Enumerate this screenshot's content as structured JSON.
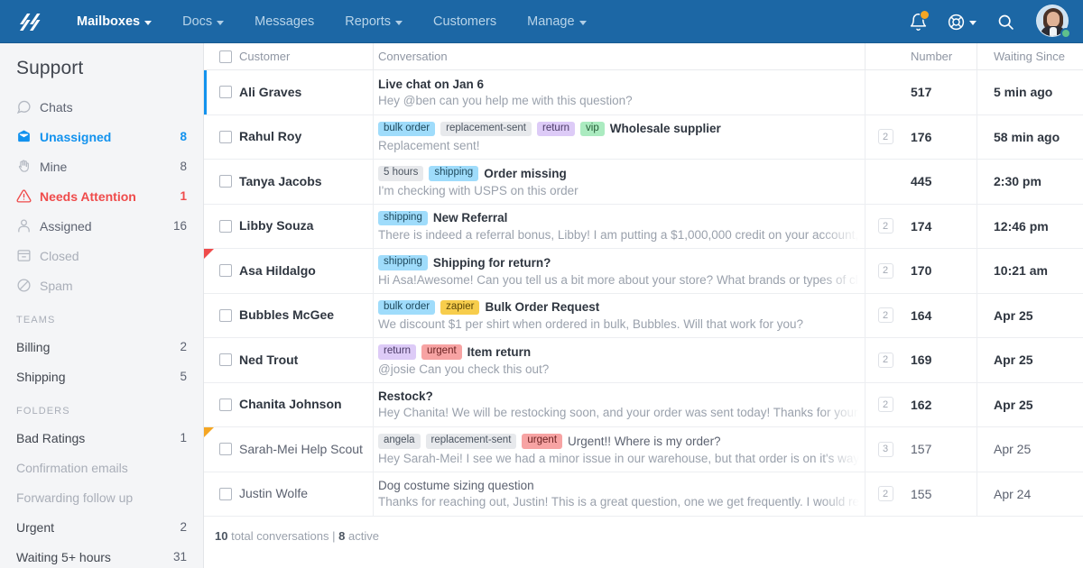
{
  "topnav": {
    "logo_name": "helpscout-logo",
    "items": [
      {
        "label": "Mailboxes",
        "caret": true,
        "active": true
      },
      {
        "label": "Docs",
        "caret": true,
        "active": false
      },
      {
        "label": "Messages",
        "caret": false,
        "active": false
      },
      {
        "label": "Reports",
        "caret": true,
        "active": false
      },
      {
        "label": "Customers",
        "caret": false,
        "active": false
      },
      {
        "label": "Manage",
        "caret": true,
        "active": false
      }
    ],
    "icons": [
      "bell-icon",
      "lifebuoy-help-icon",
      "search-icon",
      "avatar"
    ],
    "notification_badge": true,
    "status": "online",
    "bg_color": "#1c67a5"
  },
  "sidebar": {
    "title": "Support",
    "items": [
      {
        "label": "Chats",
        "count": "",
        "icon": "chat-bubble-icon",
        "state": "normal"
      },
      {
        "label": "Unassigned",
        "count": "8",
        "icon": "envelope-icon",
        "state": "selected"
      },
      {
        "label": "Mine",
        "count": "8",
        "icon": "hand-icon",
        "state": "normal"
      },
      {
        "label": "Needs Attention",
        "count": "1",
        "icon": "warning-icon",
        "state": "alert"
      },
      {
        "label": "Assigned",
        "count": "16",
        "icon": "person-icon",
        "state": "normal"
      },
      {
        "label": "Closed",
        "count": "",
        "icon": "archive-icon",
        "state": "muted"
      },
      {
        "label": "Spam",
        "count": "",
        "icon": "ban-icon",
        "state": "muted"
      }
    ],
    "teams_header": "TEAMS",
    "teams": [
      {
        "label": "Billing",
        "count": "2",
        "state": "normal"
      },
      {
        "label": "Shipping",
        "count": "5",
        "state": "normal"
      }
    ],
    "folders_header": "FOLDERS",
    "folders": [
      {
        "label": "Bad Ratings",
        "count": "1",
        "state": "normal"
      },
      {
        "label": "Confirmation emails",
        "count": "",
        "state": "muted"
      },
      {
        "label": "Forwarding follow up",
        "count": "",
        "state": "muted"
      },
      {
        "label": "Urgent",
        "count": "2",
        "state": "normal"
      },
      {
        "label": "Waiting 5+ hours",
        "count": "31",
        "state": "normal"
      }
    ],
    "accent_selected": "#1292ee",
    "accent_alert": "#ef4b4b"
  },
  "table": {
    "headers": {
      "customer": "Customer",
      "conversation": "Conversation",
      "number": "Number",
      "waiting_since": "Waiting Since"
    },
    "rows": [
      {
        "customer": "Ali Graves",
        "tags": [],
        "subject": "Live chat on Jan 6",
        "preview": "Hey @ben can you help me with this question?",
        "count": "",
        "number": "517",
        "waiting": "5 min ago",
        "unread": true,
        "marker": "selected"
      },
      {
        "customer": "Rahul Roy",
        "tags": [
          {
            "label": "bulk order",
            "color": "blue"
          },
          {
            "label": "replacement-sent",
            "color": "grey"
          },
          {
            "label": "return",
            "color": "purple"
          },
          {
            "label": "vip",
            "color": "green"
          }
        ],
        "subject": "Wholesale supplier",
        "preview": "Replacement sent!",
        "count": "2",
        "number": "176",
        "waiting": "58 min ago",
        "unread": true,
        "marker": "none"
      },
      {
        "customer": "Tanya Jacobs",
        "tags": [
          {
            "label": "5 hours",
            "color": "grey"
          },
          {
            "label": "shipping",
            "color": "blue"
          }
        ],
        "subject": "Order missing",
        "preview": "I'm checking with USPS on this order",
        "count": "",
        "number": "445",
        "waiting": "2:30 pm",
        "unread": true,
        "marker": "none"
      },
      {
        "customer": "Libby Souza",
        "tags": [
          {
            "label": "shipping",
            "color": "blue"
          }
        ],
        "subject": "New Referral",
        "preview": "There is indeed a referral bonus, Libby! I am putting a $1,000,000 credit on your account, so you shou",
        "count": "2",
        "number": "174",
        "waiting": "12:46 pm",
        "unread": true,
        "marker": "none"
      },
      {
        "customer": "Asa Hildalgo",
        "tags": [
          {
            "label": "shipping",
            "color": "blue"
          }
        ],
        "subject": "Shipping for return?",
        "preview": "Hi Asa!Awesome! Can you tell us a bit more about your store? What brands or types of clothing do yo",
        "count": "2",
        "number": "170",
        "waiting": "10:21 am",
        "unread": true,
        "marker": "red"
      },
      {
        "customer": "Bubbles McGee",
        "tags": [
          {
            "label": "bulk order",
            "color": "blue"
          },
          {
            "label": "zapier",
            "color": "yellow"
          }
        ],
        "subject": "Bulk Order Request",
        "preview": "We discount $1 per shirt when ordered in bulk, Bubbles. Will that work for you?",
        "count": "2",
        "number": "164",
        "waiting": "Apr 25",
        "unread": true,
        "marker": "none"
      },
      {
        "customer": "Ned Trout",
        "tags": [
          {
            "label": "return",
            "color": "purple"
          },
          {
            "label": "urgent",
            "color": "red"
          }
        ],
        "subject": "Item return",
        "preview": "@josie Can  you check this out?",
        "count": "2",
        "number": "169",
        "waiting": "Apr 25",
        "unread": true,
        "marker": "none"
      },
      {
        "customer": "Chanita Johnson",
        "tags": [],
        "subject": "Restock?",
        "preview": "Hey Chanita! We will be restocking soon, and your order was sent today! Thanks for your patience!",
        "count": "2",
        "number": "162",
        "waiting": "Apr 25",
        "unread": true,
        "marker": "none"
      },
      {
        "customer": "Sarah-Mei Help Scout",
        "tags": [
          {
            "label": "angela",
            "color": "grey"
          },
          {
            "label": "replacement-sent",
            "color": "grey"
          },
          {
            "label": "urgent",
            "color": "red"
          }
        ],
        "subject": "Urgent!! Where is my order?",
        "preview": "Hey Sarah-Mei! I see we had a minor issue in our warehouse, but that order is on it's way to you now!",
        "count": "3",
        "number": "157",
        "waiting": "Apr 25",
        "unread": false,
        "marker": "orange"
      },
      {
        "customer": "Justin Wolfe",
        "tags": [],
        "subject": "Dog costume sizing question",
        "preview": "Thanks for reaching out, Justin! This is a great question, one we get frequently. I would recommend a",
        "count": "2",
        "number": "155",
        "waiting": "Apr 24",
        "unread": false,
        "marker": "none"
      }
    ],
    "footer": {
      "total": "10",
      "total_label": "total conversations",
      "divider": "|",
      "active": "8",
      "active_label": "active"
    }
  }
}
